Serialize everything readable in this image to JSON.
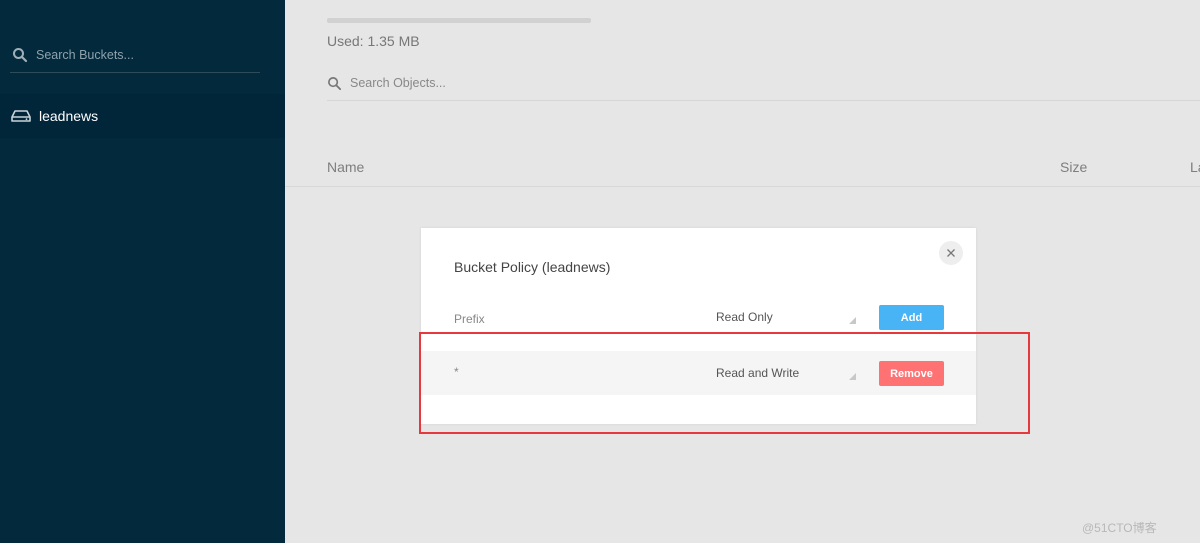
{
  "sidebar": {
    "search_placeholder": "Search Buckets...",
    "search_icon": "search-icon",
    "buckets": [
      {
        "name": "leadnews",
        "icon": "drive-icon"
      }
    ]
  },
  "main": {
    "usage_fraction": 0.0,
    "used_text": "Used: 1.35 MB",
    "search_placeholder": "Search Objects...",
    "columns": {
      "name": "Name",
      "size": "Size",
      "last_modified_partial": "La"
    }
  },
  "modal": {
    "title": "Bucket Policy (leadnews)",
    "close_icon": "close-icon",
    "new_policy": {
      "prefix_placeholder": "Prefix",
      "access": "Read Only",
      "button": "Add"
    },
    "policies": [
      {
        "prefix": "*",
        "access": "Read and Write",
        "button": "Remove"
      }
    ]
  },
  "colors": {
    "sidebar_bg": "#022a3c",
    "add_button": "#48b3f5",
    "remove_button": "#ff7274",
    "highlight": "#e6393b"
  },
  "watermark": "@51CTO博客"
}
